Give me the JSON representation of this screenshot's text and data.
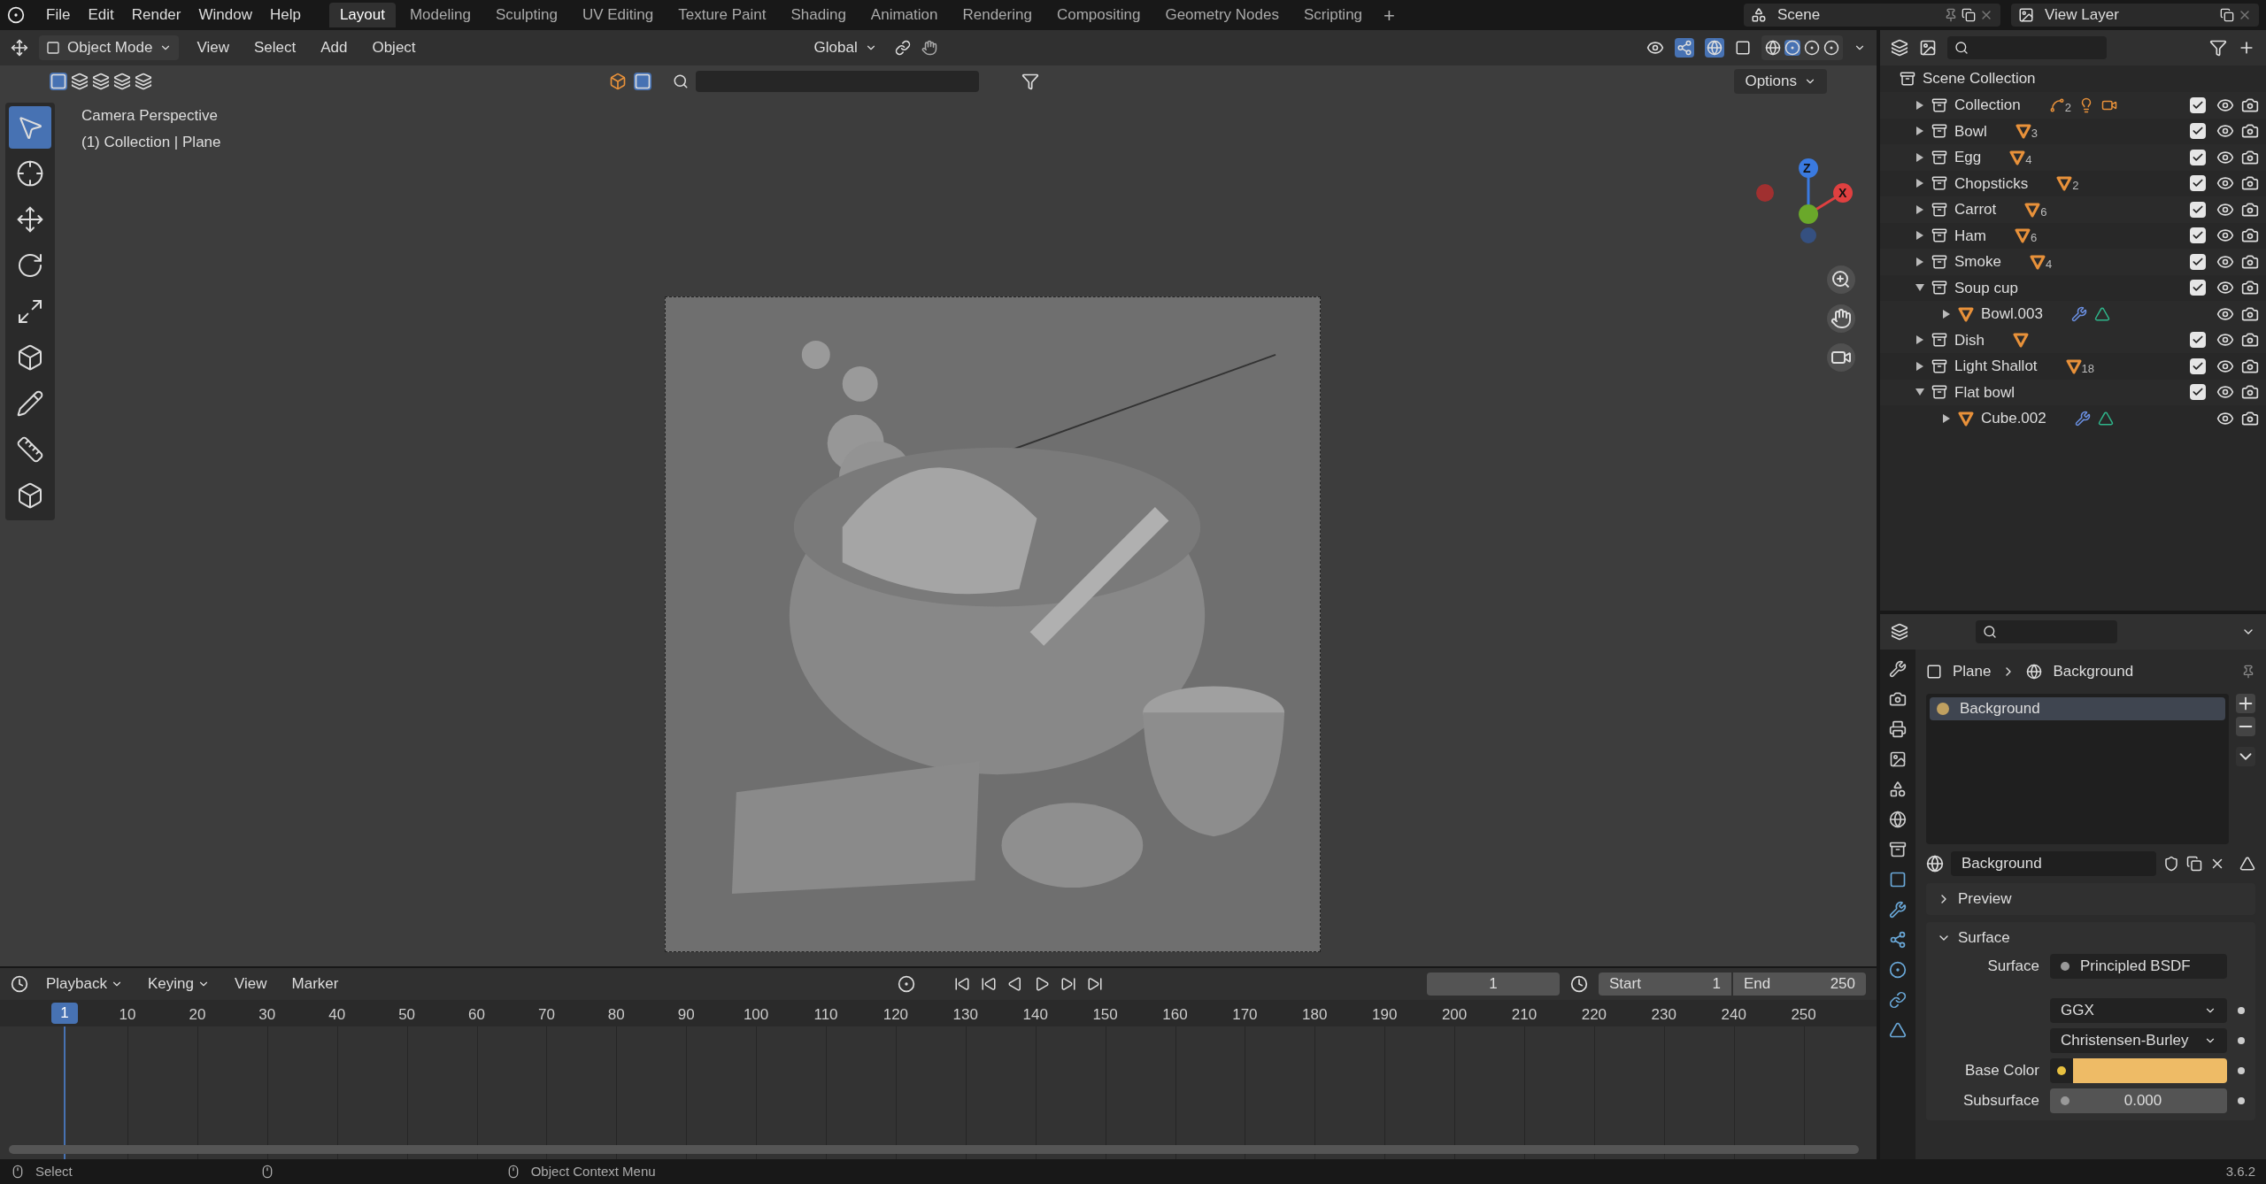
{
  "menu": [
    "File",
    "Edit",
    "Render",
    "Window",
    "Help"
  ],
  "workspaces": [
    {
      "label": "Layout",
      "selected": true
    },
    {
      "label": "Modeling",
      "selected": false
    },
    {
      "label": "Sculpting",
      "selected": false
    },
    {
      "label": "UV Editing",
      "selected": false
    },
    {
      "label": "Texture Paint",
      "selected": false
    },
    {
      "label": "Shading",
      "selected": false
    },
    {
      "label": "Animation",
      "selected": false
    },
    {
      "label": "Rendering",
      "selected": false
    },
    {
      "label": "Compositing",
      "selected": false
    },
    {
      "label": "Geometry Nodes",
      "selected": false
    },
    {
      "label": "Scripting",
      "selected": false
    }
  ],
  "add_workspace": "+",
  "scene": "Scene",
  "view_layer": "View Layer",
  "viewport_header": {
    "mode": "Object Mode",
    "menus": [
      "View",
      "Select",
      "Add",
      "Object"
    ],
    "orientation": "Global",
    "options": "Options"
  },
  "viewport": {
    "camera_label": "Camera Perspective",
    "object_label": "(1) Collection | Plane",
    "gizmo_axes": [
      "Z",
      "X"
    ]
  },
  "outliner": {
    "root": "Scene Collection",
    "items": [
      {
        "name": "Collection",
        "kind": "collection",
        "expanded": false,
        "checked": true,
        "badges": [
          {
            "kind": "curve",
            "count": "2"
          },
          {
            "kind": "light"
          },
          {
            "kind": "camera"
          }
        ]
      },
      {
        "name": "Bowl",
        "kind": "collection",
        "expanded": false,
        "checked": true,
        "badges": [
          {
            "kind": "mesh",
            "count": "3"
          }
        ]
      },
      {
        "name": "Egg",
        "kind": "collection",
        "expanded": false,
        "checked": true,
        "badges": [
          {
            "kind": "mesh",
            "count": "4"
          }
        ]
      },
      {
        "name": "Chopsticks",
        "kind": "collection",
        "expanded": false,
        "checked": true,
        "badges": [
          {
            "kind": "mesh",
            "count": "2"
          }
        ]
      },
      {
        "name": "Carrot",
        "kind": "collection",
        "expanded": false,
        "checked": true,
        "badges": [
          {
            "kind": "mesh",
            "count": "6"
          }
        ]
      },
      {
        "name": "Ham",
        "kind": "collection",
        "expanded": false,
        "checked": true,
        "badges": [
          {
            "kind": "mesh",
            "count": "6"
          }
        ]
      },
      {
        "name": "Smoke",
        "kind": "collection",
        "expanded": false,
        "checked": true,
        "badges": [
          {
            "kind": "mesh",
            "count": "4"
          }
        ]
      },
      {
        "name": "Soup cup",
        "kind": "collection",
        "expanded": true,
        "checked": true,
        "children": [
          {
            "name": "Bowl.003",
            "kind": "object",
            "expanded": false,
            "badges": [
              {
                "kind": "modifier"
              },
              {
                "kind": "meshdata"
              }
            ]
          }
        ]
      },
      {
        "name": "Dish",
        "kind": "collection",
        "expanded": false,
        "checked": true,
        "badges": [
          {
            "kind": "mesh"
          }
        ]
      },
      {
        "name": "Light Shallot",
        "kind": "collection",
        "expanded": false,
        "checked": true,
        "badges": [
          {
            "kind": "mesh",
            "count": "18"
          }
        ]
      },
      {
        "name": "Flat bowl",
        "kind": "collection",
        "expanded": true,
        "checked": true,
        "children": [
          {
            "name": "Cube.002",
            "kind": "object",
            "expanded": false,
            "badges": [
              {
                "kind": "modifier"
              },
              {
                "kind": "meshdata"
              }
            ]
          }
        ]
      }
    ]
  },
  "properties": {
    "breadcrumb": [
      "Plane",
      "Background"
    ],
    "slots": [
      {
        "name": "Background",
        "selected": true
      }
    ],
    "material": "Background",
    "panels": [
      {
        "title": "Preview",
        "expanded": false
      },
      {
        "title": "Surface",
        "expanded": true
      }
    ],
    "fields": [
      {
        "kind": "socket",
        "label": "Surface",
        "value": "Principled BSDF"
      },
      {
        "kind": "dropdown",
        "value": "GGX"
      },
      {
        "kind": "dropdown",
        "value": "Christensen-Burley"
      },
      {
        "kind": "color",
        "label": "Base Color",
        "color": "#eebb66"
      },
      {
        "kind": "number",
        "label": "Subsurface",
        "value": "0.000"
      }
    ]
  },
  "timeline": {
    "menus": [
      "Playback",
      "Keying",
      "View",
      "Marker"
    ],
    "frame": "1",
    "start_label": "Start",
    "start": "1",
    "end_label": "End",
    "end": "250",
    "current": "1",
    "ticks": [
      "10",
      "20",
      "30",
      "40",
      "50",
      "60",
      "70",
      "80",
      "90",
      "100",
      "110",
      "120",
      "130",
      "140",
      "150",
      "160",
      "170",
      "180",
      "190",
      "200",
      "210",
      "220",
      "230",
      "240",
      "250"
    ]
  },
  "status": {
    "hints": [
      "Select",
      "Object Context Menu"
    ],
    "version": "3.6.2"
  }
}
